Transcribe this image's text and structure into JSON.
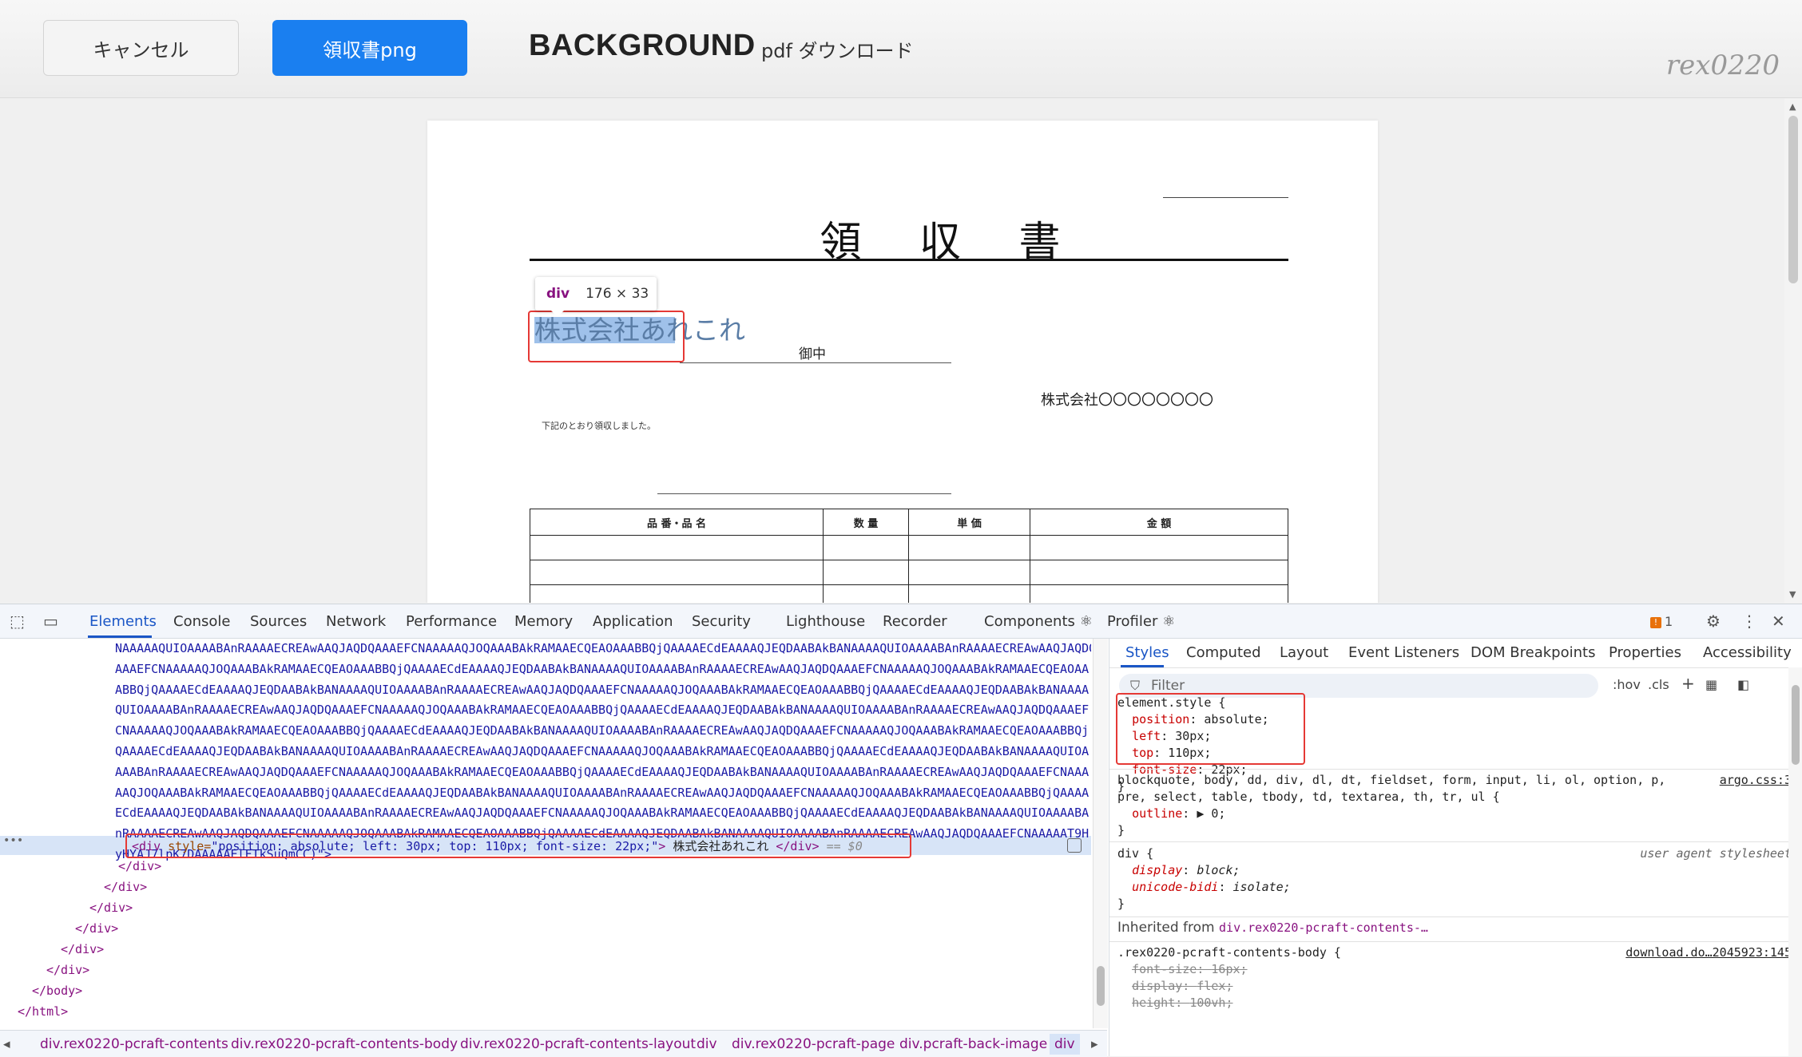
{
  "header": {
    "cancel_label": "キャンセル",
    "png_label": "領収書png",
    "title": "BACKGROUND",
    "subtitle": "pdf ダウンロード",
    "brand": "rex0220"
  },
  "document": {
    "title": "領 収 書",
    "tooltip_tag": "div",
    "tooltip_size": "176 × 33",
    "company_name": "株式会社あれこれ",
    "honorific": "御中",
    "issuer": "株式会社〇〇〇〇〇〇〇〇",
    "note": "下記のとおり領収しました。",
    "table_headers": [
      "品 番・品 名",
      "数 量",
      "単 価",
      "金 額"
    ],
    "empty_rows": 3
  },
  "devtools": {
    "tabs": [
      "Elements",
      "Console",
      "Sources",
      "Network",
      "Performance",
      "Memory",
      "Application",
      "Security",
      "Lighthouse",
      "Recorder",
      "Components ⚛",
      "Profiler ⚛"
    ],
    "issues_count": "1",
    "base64_lines": [
      "NAAAAAQUIOAAAABAnRAAAAECREAwAAQJAQDQAAAEFCNAAAAAQJOQAAABAkRAMAAECQEAOAAABBQjQAAAAECdEAAAAQJEQDAABAkBANAAAAQUIOAAAABAnRAAAAECREAwAAQJAQDQ",
      "AAAEFCNAAAAAQJOQAAABAkRAMAAECQEAOAAABBQjQAAAAECdEAAAAQJEQDAABAkBANAAAAQUIOAAAABAnRAAAAECREAwAAQJAQDQAAAEFCNAAAAAQJOQAAABAkRAMAAECQEAOAA",
      "ABBQjQAAAAECdEAAAAQJEQDAABAkBANAAAAQUIOAAAABAnRAAAAECREAwAAQJAQDQAAAEFCNAAAAAQJOQAAABAkRAMAAECQEAOAAABBQjQAAAAECdEAAAAQJEQDAABAkBANAAAA",
      "QUIOAAAABAnRAAAAECREAwAAQJAQDQAAAEFCNAAAAAQJOQAAABAkRAMAAECQEAOAAABBQjQAAAAECdEAAAAQJEQDAABAkBANAAAAQUIOAAAABAnRAAAAECREAwAAQJAQDQAAAEF",
      "CNAAAAAQJOQAAABAkRAMAAECQEAOAAABBQjQAAAAECdEAAAAQJEQDAABAkBANAAAAQUIOAAAABAnRAAAAECREAwAAQJAQDQAAAEFCNAAAAAQJOQAAABAkRAMAAECQEAOAAABBQj",
      "QAAAAECdEAAAAQJEQDAABAkBANAAAAQUIOAAAABAnRAAAAECREAwAAQJAQDQAAAEFCNAAAAAQJOQAAABAkRAMAAECQEAOAAABBQjQAAAAECdEAAAAQJEQDAABAkBANAAAAQUIOA",
      "AAABAnRAAAAECREAwAAQJAQDQAAAEFCNAAAAAQJOQAAABAkRAMAAECQEAOAAABBQjQAAAAECdEAAAAQJEQDAABAkBANAAAAQUIOAAAABAnRAAAAECREAwAAQJAQDQAAAEFCNAAA",
      "AAQJOQAAABAkRAMAAECQEAOAAABBQjQAAAAECdEAAAAQJEQDAABAkBANAAAAQUIOAAAABAnRAAAAECREAwAAQJAQDQAAAEFCNAAAAAQJOQAAABAkRAMAAECQEAOAAABBQjQAAAA",
      "ECdEAAAAQJEQDAABAkBANAAAAQUIOAAAABAnRAAAAECREAwAAQJAQDQAAAEFCNAAAAAQJOQAAABAkRAMAAECQEAOAAABBQjQAAAAECdEAAAAQJEQDAABAkBANAAAAQUIOAAAABA",
      "nRAAAAECREAwAAQJAQDQAAAEFCNAAAAAQJOQAAABAkRAMAAECQEAOAAABBQjQAAAAECdEAAAAQJEQDAABAkBANAAAAQUIOAAAABAnRAAAAECREAwAAQJAQDQAAAEFCNAAAAAT9H",
      "yHYAJ7lpK7DAAAAAElFTkSuQmCC)\">"
    ],
    "selected": {
      "open_tag": "<div",
      "attr_name": " style=",
      "attr_value": "\"position: absolute; left: 30px; top: 110px; font-size: 22px;\"",
      "open_close": ">",
      "text": " 株式会社あれこれ ",
      "close_tag": "</div>",
      "suffix": " == $0"
    },
    "closing_lines": [
      "</div>",
      "</div>",
      "</div>",
      "</div>",
      "</div>",
      "</div>",
      "</body>",
      "</html>"
    ],
    "breadcrumbs": [
      "div.rex0220-pcraft-contents",
      "div.rex0220-pcraft-contents-body",
      "div.rex0220-pcraft-contents-layout",
      "div",
      "div.rex0220-pcraft-page",
      "div.pcraft-back-image",
      "div"
    ],
    "style_tabs": [
      "Styles",
      "Computed",
      "Layout",
      "Event Listeners",
      "DOM Breakpoints",
      "Properties",
      "Accessibility"
    ],
    "filter_placeholder": "Filter",
    "hov_label": ":hov",
    "cls_label": ".cls",
    "element_style": {
      "selector": "element.style {",
      "props": [
        {
          "name": "position",
          "value": "absolute;"
        },
        {
          "name": "left",
          "value": "30px;"
        },
        {
          "name": "top",
          "value": "110px;"
        },
        {
          "name": "font-size",
          "value": "22px;"
        }
      ],
      "close": "}"
    },
    "argo_rule": {
      "selector1": "blockquote, body, dd, div, dl, dt, fieldset, form, input, li, ol, option, p,",
      "selector2": "pre, select, table, tbody, td, textarea, th, tr, ul {",
      "prop": "outline",
      "value": "▶ 0;",
      "source": "argo.css:3",
      "close": "}"
    },
    "ua_rule": {
      "selector": "div {",
      "source": "user agent stylesheet",
      "props": [
        {
          "name": "display",
          "value": "block;"
        },
        {
          "name": "unicode-bidi",
          "value": "isolate;"
        }
      ],
      "close": "}"
    },
    "inherited": {
      "label": "Inherited from ",
      "link": "div.rex0220-pcraft-contents-…"
    },
    "body_rule": {
      "selector": ".rex0220-pcraft-contents-body {",
      "source": "download.do…2045923:145",
      "props": [
        {
          "name": "font-size",
          "value": "16px;"
        },
        {
          "name": "display",
          "value": "flex;"
        },
        {
          "name": "height",
          "value": "100vh;"
        }
      ]
    }
  }
}
